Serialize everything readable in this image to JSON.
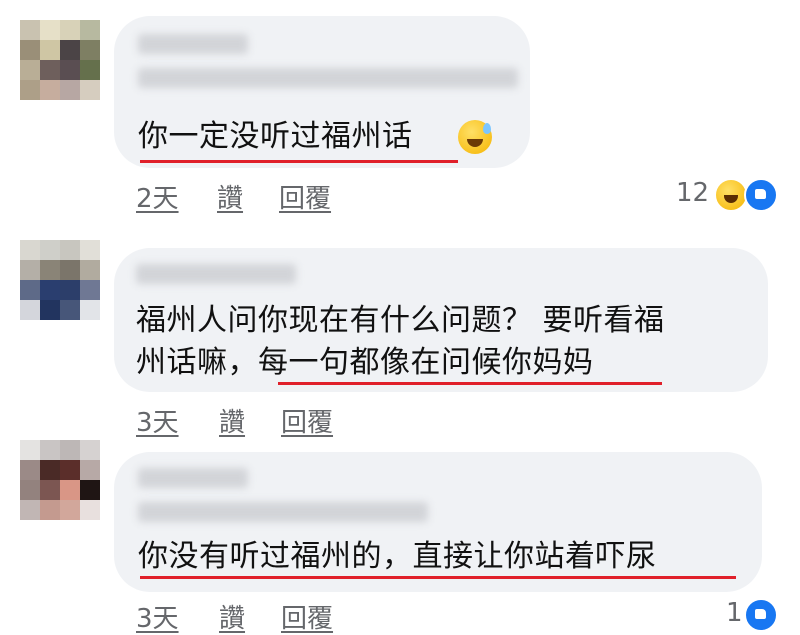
{
  "comments": [
    {
      "lines": [
        "你一定没听过福州话"
      ],
      "time": "2天",
      "like_label": "讚",
      "reply_label": "回覆",
      "reaction_count": "12",
      "reactions": [
        "haha-icon",
        "like-icon"
      ]
    },
    {
      "lines": [
        "福州人问你现在有什么问题？ 要听看福",
        "州话嘛，每一句都像在问候你妈妈"
      ],
      "time": "3天",
      "like_label": "讚",
      "reply_label": "回覆",
      "reaction_count": "",
      "reactions": []
    },
    {
      "lines": [
        "你没有听过福州的，直接让你站着吓尿"
      ],
      "time": "3天",
      "like_label": "讚",
      "reply_label": "回覆",
      "reaction_count": "1",
      "reactions": [
        "like-icon"
      ]
    }
  ],
  "colors": {
    "bubble": "#f0f2f5",
    "underline": "#e0202a",
    "meta": "#65676b",
    "like": "#1877f2"
  }
}
